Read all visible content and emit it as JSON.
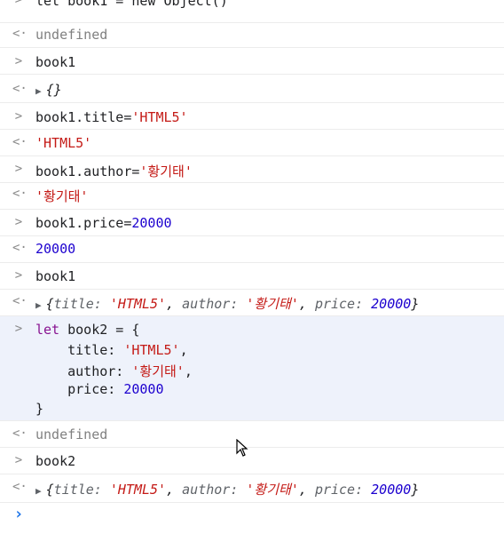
{
  "console": {
    "input_glyph": ">",
    "output_glyph": "<·",
    "prompt_glyph": "›",
    "entries": [
      {
        "kind": "input",
        "text": "let book1 = new Object()"
      },
      {
        "kind": "output",
        "text": "undefined"
      },
      {
        "kind": "input",
        "text": "book1"
      },
      {
        "kind": "output",
        "text": "{}"
      },
      {
        "kind": "input",
        "prefix": "book1.title=",
        "value": "'HTML5'"
      },
      {
        "kind": "output",
        "text": "'HTML5'"
      },
      {
        "kind": "input",
        "prefix": "book1.author=",
        "value": "'황기태'"
      },
      {
        "kind": "output",
        "text": "'황기태'"
      },
      {
        "kind": "input",
        "prefix": "book1.price=",
        "value": "20000"
      },
      {
        "kind": "output",
        "text": "20000"
      },
      {
        "kind": "input",
        "text": "book1"
      },
      {
        "kind": "output",
        "object": {
          "title_key": "title:",
          "title_val": "'HTML5'",
          "author_key": "author:",
          "author_val": "'황기태'",
          "price_key": "price:",
          "price_val": "20000"
        }
      },
      {
        "kind": "input",
        "lines": {
          "l1_kw": "let",
          "l1_rest": " book2 = {",
          "l2_key": "    title: ",
          "l2_val": "'HTML5'",
          "l2_end": ",",
          "l3_key": "    author: ",
          "l3_val": "'황기태'",
          "l3_end": ",",
          "l4_key": "    price: ",
          "l4_val": "20000",
          "l5": "}"
        }
      },
      {
        "kind": "output",
        "text": "undefined"
      },
      {
        "kind": "input",
        "text": "book2"
      },
      {
        "kind": "output",
        "object": {
          "title_key": "title:",
          "title_val": "'HTML5'",
          "author_key": "author:",
          "author_val": "'황기태'",
          "price_key": "price:",
          "price_val": "20000"
        }
      }
    ]
  }
}
